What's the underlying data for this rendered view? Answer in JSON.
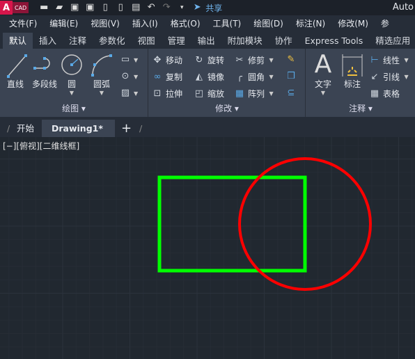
{
  "titlebar": {
    "logo_letter": "A",
    "logo_text": "CAD",
    "share_label": "共享",
    "app_title": "Auto",
    "quick_access": [
      "new-icon",
      "open-icon",
      "save-icon",
      "save-as-icon",
      "open-web-icon",
      "save-web-icon",
      "plot-icon",
      "undo-icon",
      "redo-icon",
      "customize-icon"
    ]
  },
  "menu": [
    "文件(F)",
    "编辑(E)",
    "视图(V)",
    "插入(I)",
    "格式(O)",
    "工具(T)",
    "绘图(D)",
    "标注(N)",
    "修改(M)",
    "参"
  ],
  "ribbon_tabs": [
    "默认",
    "插入",
    "注释",
    "参数化",
    "视图",
    "管理",
    "输出",
    "附加模块",
    "协作",
    "Express Tools",
    "精选应用"
  ],
  "active_ribbon_tab": "默认",
  "draw_panel": {
    "title": "绘图",
    "tools": [
      "直线",
      "多段线",
      "圆",
      "圆弧"
    ]
  },
  "modify_panel": {
    "title": "修改",
    "tools": [
      "移动",
      "旋转",
      "修剪",
      "复制",
      "镜像",
      "圆角",
      "拉伸",
      "缩放",
      "阵列"
    ]
  },
  "annotation_panel": {
    "title": "注释",
    "tools": [
      "文字",
      "标注",
      "线性",
      "引线",
      "表格"
    ]
  },
  "doc_tabs": {
    "start": "开始",
    "drawing": "Drawing1*",
    "close": "×",
    "new": "+"
  },
  "viewport": {
    "label": "[−][俯视][二维线框]"
  },
  "drawing": {
    "rectangle_color": "#00ff00",
    "circle_color": "#ff0000"
  },
  "colors": {
    "accent": "#d6164b",
    "share": "#6fb3ec"
  }
}
